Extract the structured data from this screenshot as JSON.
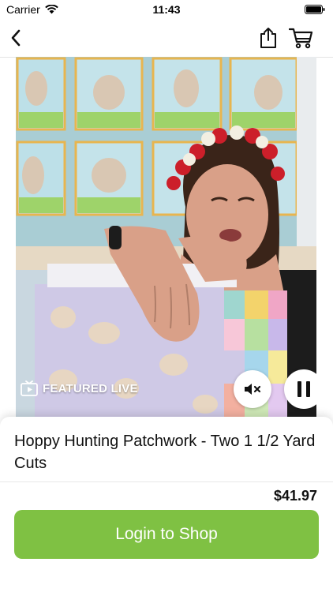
{
  "status_bar": {
    "carrier": "Carrier",
    "time": "11:43"
  },
  "nav": {
    "back_icon": "chevron-left-icon",
    "share_icon": "share-icon",
    "cart_icon": "cart-icon"
  },
  "video": {
    "badge_label": "FEATURED LIVE",
    "badge_icon": "tv-play-icon",
    "mute_icon": "speaker-mute-icon",
    "pause_icon": "pause-icon"
  },
  "product": {
    "title": "Hoppy Hunting Patchwork - Two 1 1/2 Yard Cuts",
    "price": "$41.97"
  },
  "actions": {
    "login_label": "Login to Shop"
  },
  "colors": {
    "accent_green": "#7fc143"
  }
}
